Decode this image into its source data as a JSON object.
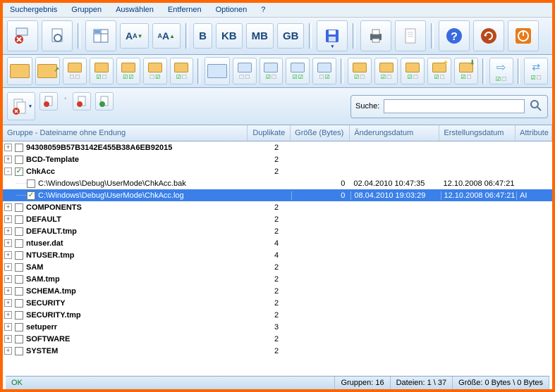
{
  "menu": [
    "Suchergebnis",
    "Gruppen",
    "Auswählen",
    "Entfernen",
    "Optionen",
    "?"
  ],
  "tb1_text": {
    "B": "B",
    "KB": "KB",
    "MB": "MB",
    "GB": "GB",
    "AA1": "A⁠A",
    "AA2": "ᴀA"
  },
  "search": {
    "label": "Suche:",
    "placeholder": ""
  },
  "headers": {
    "group": "Gruppe - Dateiname ohne Endung",
    "dup": "Duplikate",
    "size": "Größe (Bytes)",
    "mod": "Änderungsdatum",
    "create": "Erstellungsdatum",
    "attr": "Attribute"
  },
  "rows": [
    {
      "t": "g",
      "chk": false,
      "exp": "+",
      "name": "94308059B57B3142E455B38A6EB92015",
      "dup": "2",
      "bold": true
    },
    {
      "t": "g",
      "chk": false,
      "exp": "+",
      "name": "BCD-Template",
      "dup": "2",
      "bold": true
    },
    {
      "t": "g",
      "chk": true,
      "exp": "-",
      "name": "ChkAcc",
      "dup": "2",
      "bold": true
    },
    {
      "t": "f",
      "chk": false,
      "name": "C:\\Windows\\Debug\\UserMode\\ChkAcc.bak",
      "dup": "",
      "size": "0",
      "mod": "02.04.2010 10:47:35",
      "create": "12.10.2008 06:47:21",
      "attr": ""
    },
    {
      "t": "f",
      "chk": true,
      "sel": true,
      "name": "C:\\Windows\\Debug\\UserMode\\ChkAcc.log",
      "dup": "",
      "size": "0",
      "mod": "08.04.2010 19:03:29",
      "create": "12.10.2008 06:47:21",
      "attr": "AI"
    },
    {
      "t": "g",
      "chk": false,
      "exp": "+",
      "name": "COMPONENTS",
      "dup": "2",
      "bold": true
    },
    {
      "t": "g",
      "chk": false,
      "exp": "+",
      "name": "DEFAULT",
      "dup": "2",
      "bold": true
    },
    {
      "t": "g",
      "chk": false,
      "exp": "+",
      "name": "DEFAULT.tmp",
      "dup": "2",
      "bold": true
    },
    {
      "t": "g",
      "chk": false,
      "exp": "+",
      "name": "ntuser.dat",
      "dup": "4",
      "bold": true
    },
    {
      "t": "g",
      "chk": false,
      "exp": "+",
      "name": "NTUSER.tmp",
      "dup": "4",
      "bold": true
    },
    {
      "t": "g",
      "chk": false,
      "exp": "+",
      "name": "SAM",
      "dup": "2",
      "bold": true
    },
    {
      "t": "g",
      "chk": false,
      "exp": "+",
      "name": "SAM.tmp",
      "dup": "2",
      "bold": true
    },
    {
      "t": "g",
      "chk": false,
      "exp": "+",
      "name": "SCHEMA.tmp",
      "dup": "2",
      "bold": true
    },
    {
      "t": "g",
      "chk": false,
      "exp": "+",
      "name": "SECURITY",
      "dup": "2",
      "bold": true
    },
    {
      "t": "g",
      "chk": false,
      "exp": "+",
      "name": "SECURITY.tmp",
      "dup": "2",
      "bold": true
    },
    {
      "t": "g",
      "chk": false,
      "exp": "+",
      "name": "setuperr",
      "dup": "3",
      "bold": true
    },
    {
      "t": "g",
      "chk": false,
      "exp": "+",
      "name": "SOFTWARE",
      "dup": "2",
      "bold": true
    },
    {
      "t": "g",
      "chk": false,
      "exp": "+",
      "name": "SYSTEM",
      "dup": "2",
      "bold": true
    }
  ],
  "status": {
    "ok": "OK",
    "groups": "Gruppen: 16",
    "files": "Dateien: 1 \\ 37",
    "size": "Größe: 0 Bytes \\ 0 Bytes"
  }
}
